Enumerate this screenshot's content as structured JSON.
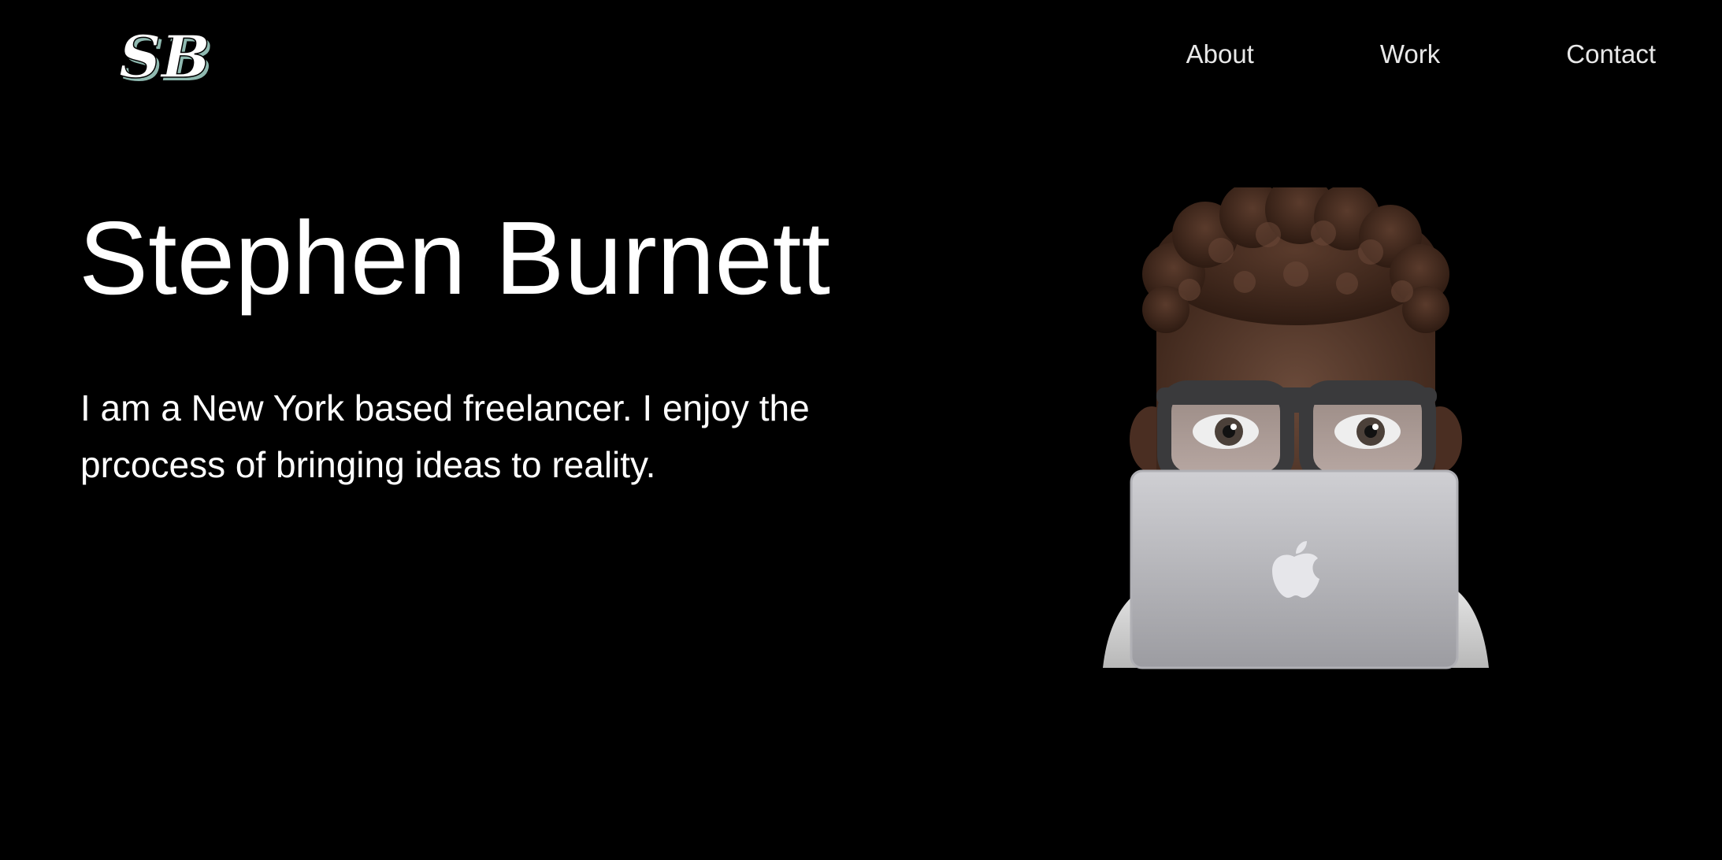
{
  "logo": {
    "text": "SB"
  },
  "nav": {
    "items": [
      {
        "label": "About"
      },
      {
        "label": "Work"
      },
      {
        "label": "Contact"
      }
    ]
  },
  "hero": {
    "title": "Stephen Burnett",
    "description": "I am a New York based freelancer. I enjoy the prcocess of bringing ideas to reality."
  },
  "colors": {
    "background": "#000000",
    "text": "#ffffff",
    "nav_text": "#e8e8e8",
    "logo_shadow": "#8fb9b0"
  },
  "icons": {
    "logo": "sb-logo-icon",
    "avatar": "memoji-laptop-avatar"
  }
}
